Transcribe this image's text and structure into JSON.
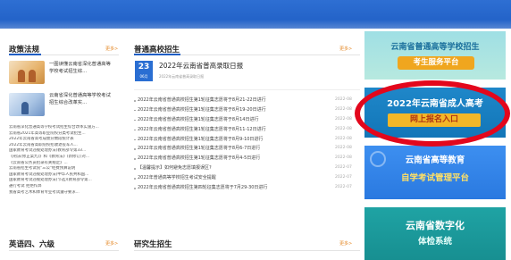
{
  "sections": {
    "policy": {
      "title": "政策法规",
      "more": "更多>"
    },
    "admission": {
      "title": "普通高校招生",
      "more": "更多>"
    },
    "english": {
      "title": "英语四、六级",
      "more": "更多>"
    },
    "postgrad": {
      "title": "研究生招生",
      "more": "更多>"
    }
  },
  "featured": [
    {
      "title": "一图读懂云南省深化普通高等学校考试招生综..."
    },
    {
      "title": "云南省深化普通高等学校考试招生综合改革实..."
    }
  ],
  "policy_list": [
    "云南省深化普通高等学校考试招生综合改革实施方...",
    "云南省2021年高等职业院校分类考试招生...",
    "2022年云南省高考成绩分数段统计表",
    "2022年云南省高职院校招收退役军人...",
    "国家教育考试违规处理办法(教育部令第33...",
    "《刑法(修正案九)》和《教育法》(新修订)对...",
    "《云南省公务员招录有关规定》...",
    "云南省招生考试院\"三公\"经费预算说明",
    "国家教育考试违规处理办法(中华人民共和国...",
    "国家教育考试违规处理办法(节选)(教育部令第...",
    "通行考试 拒绝作弊",
    "我省高考艺术和体育专业考试遵守要求..."
  ],
  "headline": {
    "day": "23",
    "month": "06月",
    "title": "2022年云南省普高录取日报",
    "subtitle": "2022年云南省普高录取日报"
  },
  "news": [
    {
      "title": "2022年云南省普通高校招生第1轮征集志愿将于8月21-22日进行",
      "date": "2022-08"
    },
    {
      "title": "2022年云南省普通高校招生第1轮征集志愿将于8月19-20日进行",
      "date": "2022-08"
    },
    {
      "title": "2022年云南省普通高校招生第1轮征集志愿将于8月14日进行",
      "date": "2022-08"
    },
    {
      "title": "2022年云南省普通高校招生第1轮征集志愿将于8月11-12日进行",
      "date": "2022-08"
    },
    {
      "title": "2022年云南省普通高校招生第1轮征集志愿将于8月9-10日进行",
      "date": "2022-08"
    },
    {
      "title": "2022年云南省普通高校招生第1轮征集志愿将于8月6-7日进行",
      "date": "2022-08"
    },
    {
      "title": "2022年云南省普通高校招生第1轮征集志愿将于8月4-5日进行",
      "date": "2022-08"
    },
    {
      "title": "【温馨提示】如何避免志愿填报误区?",
      "date": "2022-07"
    },
    {
      "title": "2022年普通高等学校招生考试安全提醒",
      "date": "2022-07"
    },
    {
      "title": "2022年云南省普通高校招生第四轮征集志愿将于7月29-30日进行",
      "date": "2022-07"
    }
  ],
  "banners": [
    {
      "title": "云南省普通高等学校招生",
      "button": "考生服务平台"
    },
    {
      "title": "2022年云南省成人高考",
      "button": "网上报名入口"
    },
    {
      "title": "云南省高等教育",
      "subtitle": "自学考试管理平台"
    },
    {
      "title": "云南省数字化",
      "subtitle": "体检系统"
    }
  ],
  "colors": {
    "brand_blue": "#1f5ec4",
    "highlight_red": "#e3071c",
    "more_orange": "#e58a2a"
  }
}
